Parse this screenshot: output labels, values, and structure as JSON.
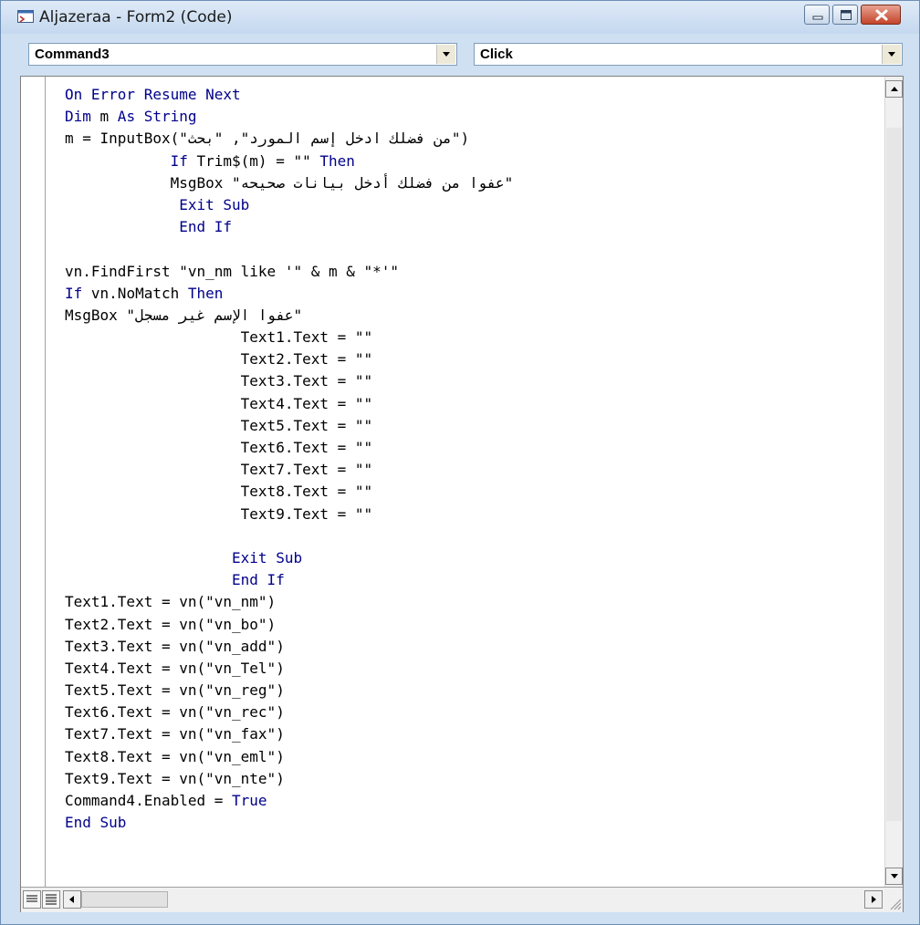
{
  "window": {
    "title": "Aljazeraa - Form2 (Code)",
    "icon": "vb-code-window-icon"
  },
  "toolbar": {
    "object_combo": "Command3",
    "procedure_combo": "Click"
  },
  "code": {
    "lines": [
      [
        {
          "t": "On Error Resume Next",
          "k": 1
        }
      ],
      [
        {
          "t": "Dim ",
          "k": 1
        },
        {
          "t": "m",
          "k": 0
        },
        {
          "t": " As String",
          "k": 1
        }
      ],
      [
        {
          "t": "m = InputBox(\"من فضلك ادخل إسم المورد\", \"بحث\")",
          "k": 0
        }
      ],
      [
        {
          "t": "            ",
          "k": 0
        },
        {
          "t": "If ",
          "k": 1
        },
        {
          "t": "Trim$(m) = \"\" ",
          "k": 0
        },
        {
          "t": "Then",
          "k": 1
        }
      ],
      [
        {
          "t": "            MsgBox \"عفوا من فضلك أدخل بيانات صحيحه\"",
          "k": 0
        }
      ],
      [
        {
          "t": "             Exit Sub",
          "k": 1
        }
      ],
      [
        {
          "t": "             End If",
          "k": 1
        }
      ],
      [
        {
          "t": "",
          "k": 0
        }
      ],
      [
        {
          "t": "vn.FindFirst \"vn_nm like '\" & m & \"*'\"",
          "k": 0
        }
      ],
      [
        {
          "t": "If ",
          "k": 1
        },
        {
          "t": "vn.NoMatch ",
          "k": 0
        },
        {
          "t": "Then",
          "k": 1
        }
      ],
      [
        {
          "t": "MsgBox \"عفوا الإسم غير مسجل\"",
          "k": 0
        }
      ],
      [
        {
          "t": "                    Text1.Text = \"\"",
          "k": 0
        }
      ],
      [
        {
          "t": "                    Text2.Text = \"\"",
          "k": 0
        }
      ],
      [
        {
          "t": "                    Text3.Text = \"\"",
          "k": 0
        }
      ],
      [
        {
          "t": "                    Text4.Text = \"\"",
          "k": 0
        }
      ],
      [
        {
          "t": "                    Text5.Text = \"\"",
          "k": 0
        }
      ],
      [
        {
          "t": "                    Text6.Text = \"\"",
          "k": 0
        }
      ],
      [
        {
          "t": "                    Text7.Text = \"\"",
          "k": 0
        }
      ],
      [
        {
          "t": "                    Text8.Text = \"\"",
          "k": 0
        }
      ],
      [
        {
          "t": "                    Text9.Text = \"\"",
          "k": 0
        }
      ],
      [
        {
          "t": "",
          "k": 0
        }
      ],
      [
        {
          "t": "                   Exit Sub",
          "k": 1
        }
      ],
      [
        {
          "t": "                   End If",
          "k": 1
        }
      ],
      [
        {
          "t": "Text1.Text = vn(\"vn_nm\")",
          "k": 0
        }
      ],
      [
        {
          "t": "Text2.Text = vn(\"vn_bo\")",
          "k": 0
        }
      ],
      [
        {
          "t": "Text3.Text = vn(\"vn_add\")",
          "k": 0
        }
      ],
      [
        {
          "t": "Text4.Text = vn(\"vn_Tel\")",
          "k": 0
        }
      ],
      [
        {
          "t": "Text5.Text = vn(\"vn_reg\")",
          "k": 0
        }
      ],
      [
        {
          "t": "Text6.Text = vn(\"vn_rec\")",
          "k": 0
        }
      ],
      [
        {
          "t": "Text7.Text = vn(\"vn_fax\")",
          "k": 0
        }
      ],
      [
        {
          "t": "Text8.Text = vn(\"vn_eml\")",
          "k": 0
        }
      ],
      [
        {
          "t": "Text9.Text = vn(\"vn_nte\")",
          "k": 0
        }
      ],
      [
        {
          "t": "Command4.Enabled = ",
          "k": 0
        },
        {
          "t": "True",
          "k": 1
        }
      ],
      [
        {
          "t": "End Sub",
          "k": 1
        }
      ]
    ]
  },
  "colors": {
    "keyword": "#00008b",
    "text": "#000000",
    "close_button": "#c44429"
  }
}
